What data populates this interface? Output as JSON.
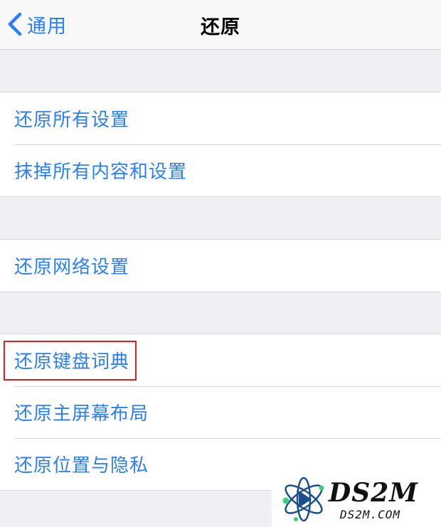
{
  "nav": {
    "back_label": "通用",
    "title": "还原"
  },
  "groups": [
    {
      "items": [
        {
          "label": "还原所有设置"
        },
        {
          "label": "抹掉所有内容和设置"
        }
      ]
    },
    {
      "items": [
        {
          "label": "还原网络设置"
        }
      ]
    },
    {
      "items": [
        {
          "label": "还原键盘词典",
          "highlighted": true
        },
        {
          "label": "还原主屏幕布局"
        },
        {
          "label": "还原位置与隐私"
        }
      ]
    }
  ],
  "watermark": {
    "title": "DS2M",
    "subtitle": "DS2M.COM"
  },
  "colors": {
    "accent": "#2a7ff6",
    "background": "#efeff4",
    "highlight": "#e02020"
  }
}
